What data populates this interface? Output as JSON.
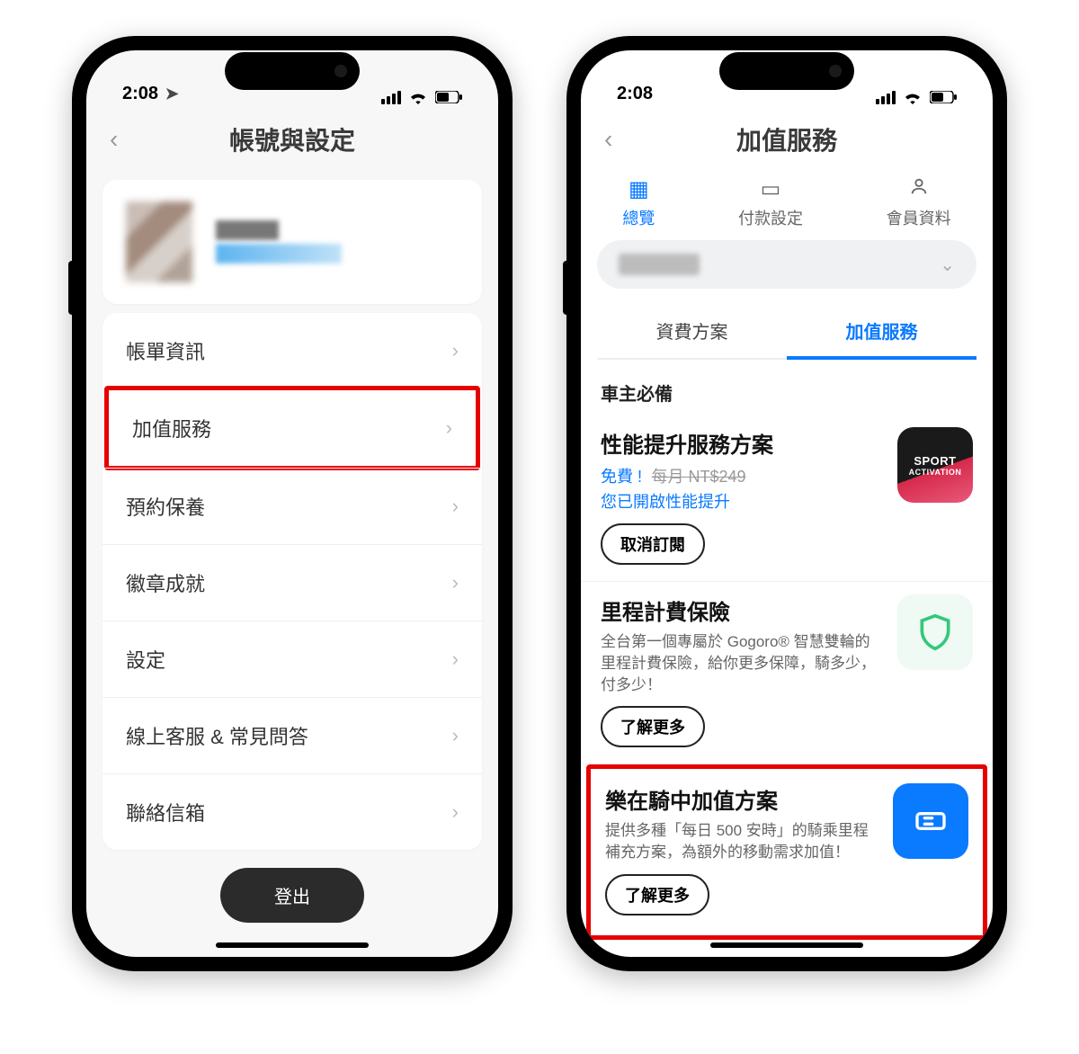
{
  "status": {
    "time": "2:08"
  },
  "screen1": {
    "title": "帳號與設定",
    "menu": {
      "billing": "帳單資訊",
      "addon": "加值服務",
      "maintenance": "預約保養",
      "badges": "徽章成就",
      "settings": "設定",
      "support": "線上客服 & 常見問答",
      "contact": "聯絡信箱"
    },
    "logout": "登出"
  },
  "screen2": {
    "title": "加值服務",
    "tabs": {
      "overview": "總覽",
      "payment": "付款設定",
      "member": "會員資料"
    },
    "subtabs": {
      "plans": "資費方案",
      "addons": "加值服務"
    },
    "section_title": "車主必備",
    "services": {
      "perf": {
        "title": "性能提升服務方案",
        "free": "免費 !",
        "strike": "每月 NT$249",
        "status": "您已開啟性能提升",
        "button": "取消訂閱",
        "badge1": "SPORT",
        "badge2": "ACTIVATION"
      },
      "insurance": {
        "title": "里程計費保險",
        "desc": "全台第一個專屬於 Gogoro® 智慧雙輪的里程計費保險，給你更多保障，騎多少，付多少！",
        "button": "了解更多"
      },
      "joyride": {
        "title": "樂在騎中加值方案",
        "desc": "提供多種「每日 500 安時」的騎乘里程補充方案，為額外的移動需求加值！",
        "button": "了解更多"
      }
    }
  }
}
